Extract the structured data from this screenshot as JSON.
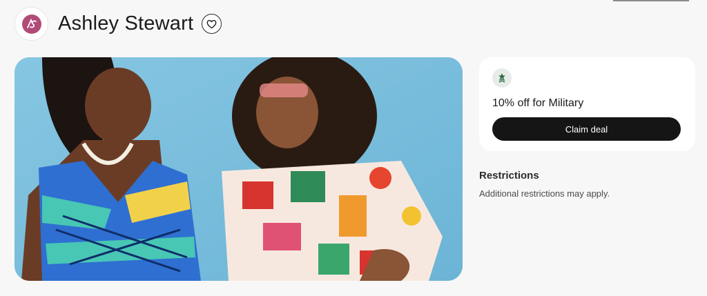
{
  "brand": {
    "name": "Ashley Stewart",
    "logo_icon": "ashley-stewart-logo",
    "favorite_icon": "heart-icon"
  },
  "hero": {
    "image": "two-women-in-colorful-print-tops-laughing"
  },
  "deal": {
    "badge_icon": "military-star-icon",
    "title": "10% off for Military",
    "button_label": "Claim deal"
  },
  "restrictions": {
    "heading": "Restrictions",
    "text": "Additional restrictions may apply."
  },
  "colors": {
    "background": "#f7f7f7",
    "card": "#ffffff",
    "button": "#151515",
    "logo": "#b04b78",
    "badge": "#e8ece9",
    "badge_icon": "#2e6b47"
  }
}
